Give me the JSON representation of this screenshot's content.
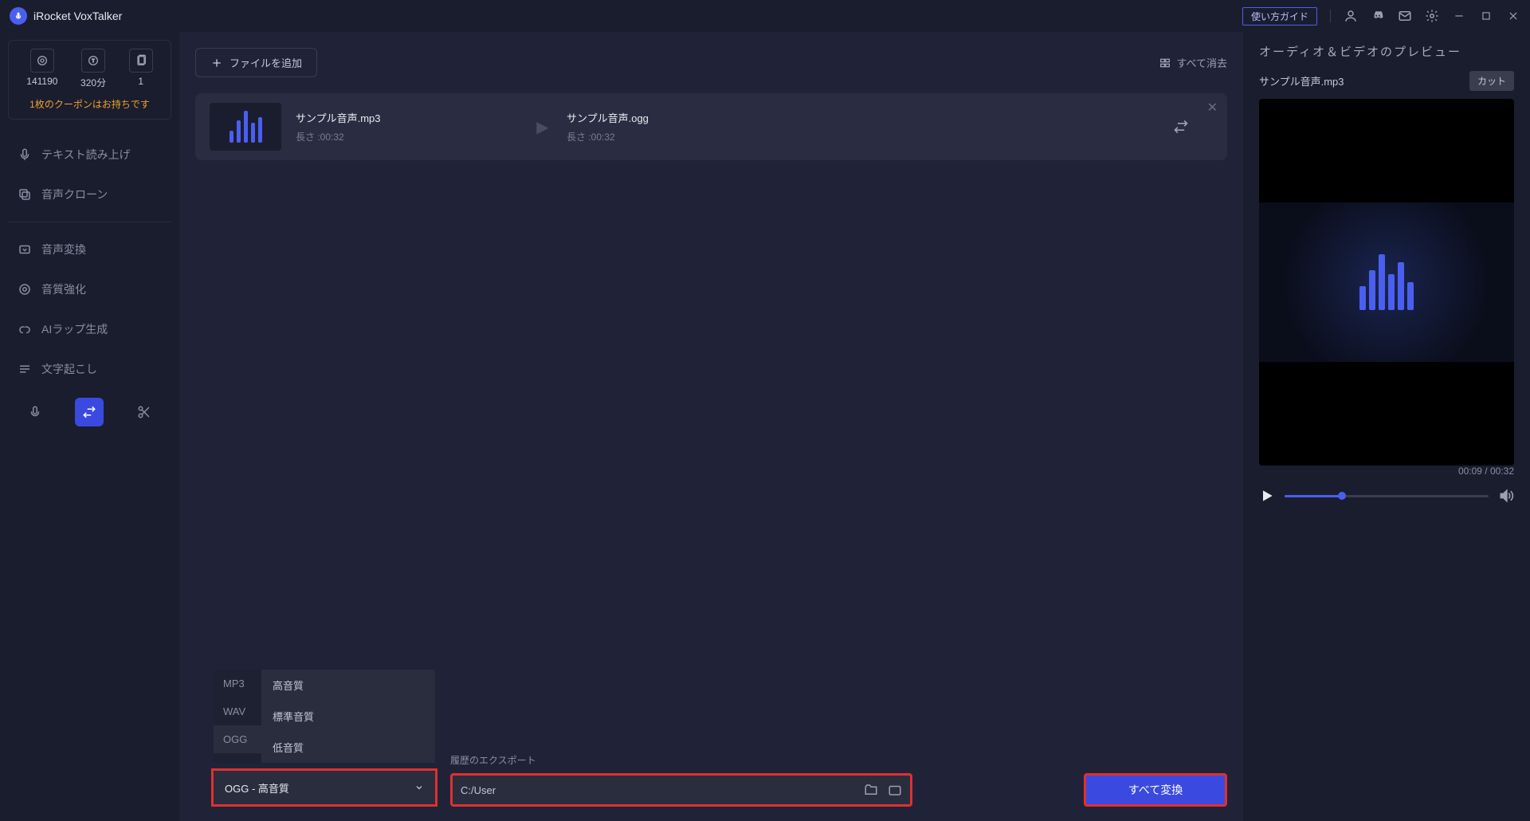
{
  "app_title": "iRocket VoxTalker",
  "titlebar": {
    "guide": "使い方ガイド"
  },
  "stats": {
    "v1": "141190",
    "v2": "320分",
    "v3": "1"
  },
  "coupon": "1枚のクーポンはお持ちです",
  "nav": {
    "tts": "テキスト読み上げ",
    "clone": "音声クローン",
    "convert": "音声変換",
    "enhance": "音質強化",
    "rap": "AIラップ生成",
    "transcribe": "文字起こし"
  },
  "toolbar": {
    "add_file": "ファイルを追加",
    "clear_all": "すべて消去"
  },
  "file": {
    "src_name": "サンプル音声.mp3",
    "src_dur": "長さ :00:32",
    "dst_name": "サンプル音声.ogg",
    "dst_dur": "長さ :00:32"
  },
  "formats": {
    "mp3": "MP3",
    "wav": "WAV",
    "ogg": "OGG"
  },
  "quality": {
    "high": "高音質",
    "std": "標準音質",
    "low": "低音質"
  },
  "dropdown": {
    "selected": "OGG - 高音質"
  },
  "export": {
    "label": "履歴のエクスポート",
    "path": "C:/User"
  },
  "convert_all": "すべて変換",
  "preview": {
    "title": "オーディオ＆ビデオのプレビュー",
    "fname": "サンプル音声.mp3",
    "cut": "カット",
    "time": "00:09 / 00:32"
  }
}
